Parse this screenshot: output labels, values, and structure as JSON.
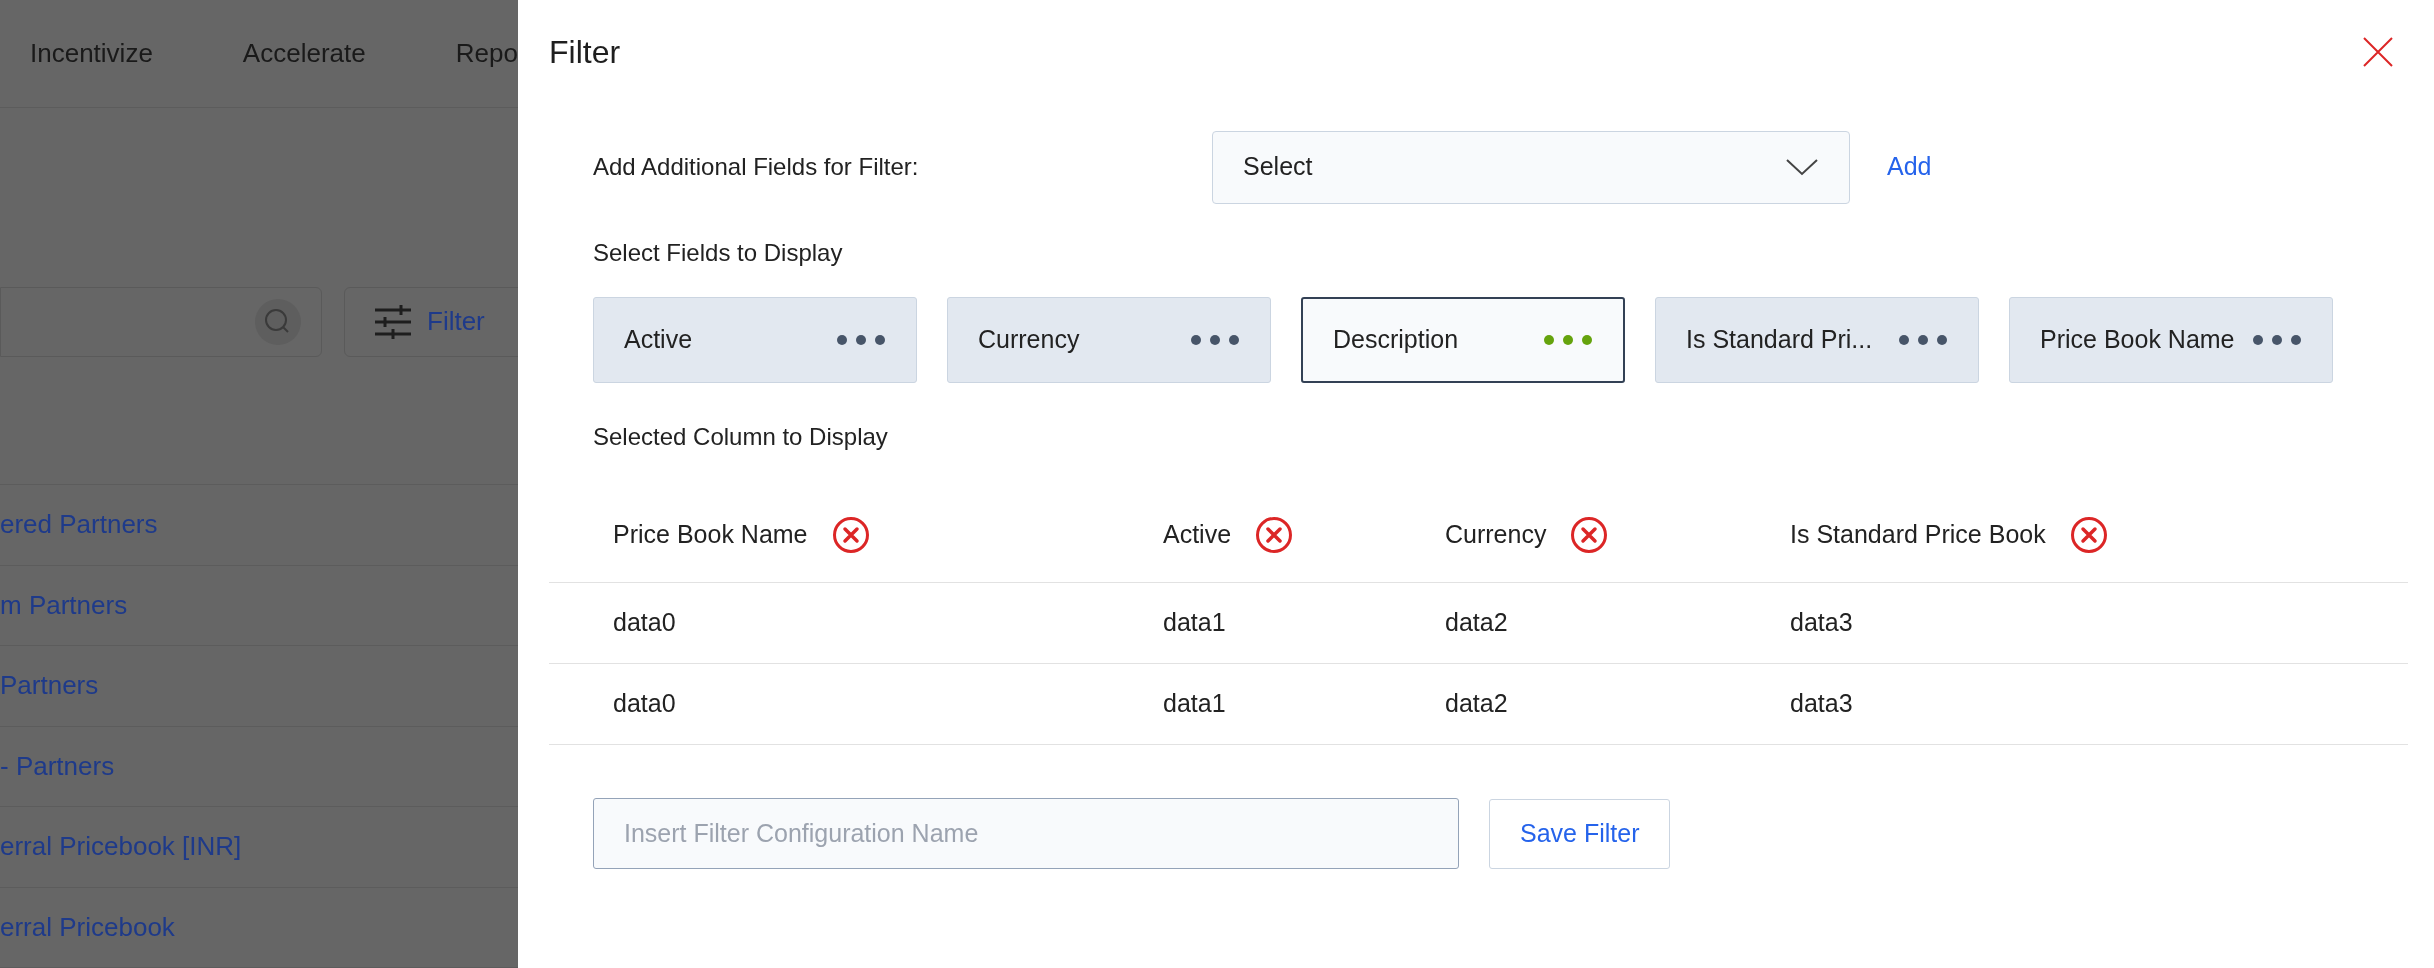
{
  "background": {
    "nav": [
      "Incentivize",
      "Accelerate",
      "Repo"
    ],
    "filter_button": "Filter",
    "list": [
      "ered Partners",
      "m Partners",
      "Partners",
      "- Partners",
      "erral Pricebook [INR]",
      "erral Pricebook"
    ]
  },
  "dialog": {
    "title": "Filter",
    "add_field": {
      "label": "Add Additional Fields for Filter:",
      "select": "Select",
      "add": "Add"
    },
    "fields_heading": "Select Fields to Display",
    "fields": [
      {
        "label": "Active",
        "selected": false
      },
      {
        "label": "Currency",
        "selected": false
      },
      {
        "label": "Description",
        "selected": true
      },
      {
        "label": "Is Standard Pri...",
        "selected": false
      },
      {
        "label": "Price Book Name",
        "selected": false
      }
    ],
    "columns_heading": "Selected Column to Display",
    "table": {
      "columns": [
        "Price Book Name",
        "Active",
        "Currency",
        "Is Standard Price Book"
      ],
      "rows": [
        [
          "data0",
          "data1",
          "data2",
          "data3"
        ],
        [
          "data0",
          "data1",
          "data2",
          "data3"
        ]
      ]
    },
    "name_field": {
      "placeholder": "Insert Filter Configuration Name"
    },
    "save": "Save Filter"
  }
}
